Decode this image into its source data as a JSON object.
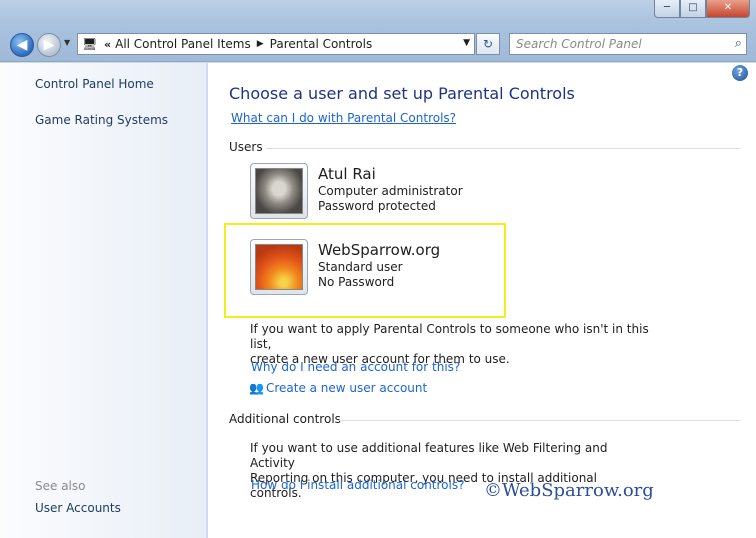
{
  "window": {
    "caption_min": "─",
    "caption_max": "□",
    "caption_close": "✕"
  },
  "navigation": {
    "back_glyph": "◀",
    "forward_glyph": "▶",
    "dropdown_glyph": "▼",
    "address_chevron": "«",
    "breadcrumb": [
      "All Control Panel Items",
      "Parental Controls"
    ],
    "separator": "▶",
    "refresh_glyph": "↻",
    "search_placeholder": "Search Control Panel",
    "search_glyph": "⌕"
  },
  "sidebar": {
    "items": [
      {
        "label": "Control Panel Home"
      },
      {
        "label": "Game Rating Systems"
      }
    ],
    "see_also_label": "See also",
    "see_also_items": [
      {
        "label": "User Accounts"
      }
    ]
  },
  "main": {
    "help_glyph": "?",
    "title": "Choose a user and set up Parental Controls",
    "help_link": "What can I do with Parental Controls?",
    "users_heading": "Users",
    "users": [
      {
        "name": "Atul Rai",
        "role": "Computer administrator",
        "password": "Password protected"
      },
      {
        "name": "WebSparrow.org",
        "role": "Standard user",
        "password": "No Password"
      }
    ],
    "info_line1": "If you want to apply Parental Controls to someone who isn't in this list,",
    "info_line2": "create a new user account for them to use.",
    "why_link": "Why do I need an account for this?",
    "create_link": "Create a new user account",
    "additional_heading": "Additional controls",
    "additional_line1": "If you want to use additional features like Web Filtering and Activity",
    "additional_line2": "Reporting on this computer, you need to install additional controls.",
    "install_link": "How do I install additional controls?",
    "watermark": "©WebSparrow.org",
    "highlight_color": "#f2ee1c"
  }
}
